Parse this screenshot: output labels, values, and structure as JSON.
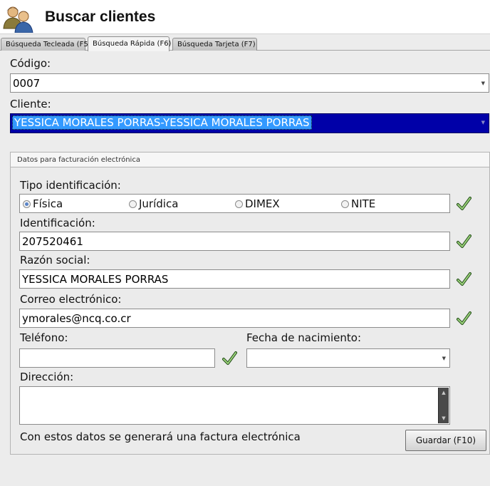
{
  "header": {
    "title": "Buscar clientes",
    "icon": "users-icon"
  },
  "tabs": [
    {
      "label": "Búsqueda Tecleada (F5)"
    },
    {
      "label": "Búsqueda Rápida (F6)",
      "active": true
    },
    {
      "label": "Búsqueda Tarjeta (F7)"
    }
  ],
  "search": {
    "code_label": "Código:",
    "code_value": "0007",
    "client_label": "Cliente:",
    "client_value": "YESSICA MORALES PORRAS-YESSICA MORALES PORRAS"
  },
  "billing": {
    "group_title": "Datos para facturación electrónica",
    "id_type_label": "Tipo identificación:",
    "id_types": [
      {
        "label": "Física",
        "selected": true
      },
      {
        "label": "Jurídica",
        "selected": false
      },
      {
        "label": "DIMEX",
        "selected": false
      },
      {
        "label": "NITE",
        "selected": false
      }
    ],
    "identification_label": "Identificación:",
    "identification_value": "207520461",
    "business_name_label": "Razón social:",
    "business_name_value": "YESSICA MORALES PORRAS",
    "email_label": "Correo electrónico:",
    "email_value": "ymorales@ncq.co.cr",
    "phone_label": "Teléfono:",
    "phone_value": "",
    "birthdate_label": "Fecha de nacimiento:",
    "birthdate_value": "",
    "address_label": "Dirección:",
    "address_value": "",
    "footer_note": "Con estos datos se generará una factura electrónica",
    "save_label": "Guardar (F10)"
  },
  "colors": {
    "selection_bg": "#0000a8",
    "text_highlight": "#3399ff",
    "check_green": "#3c8c28"
  }
}
